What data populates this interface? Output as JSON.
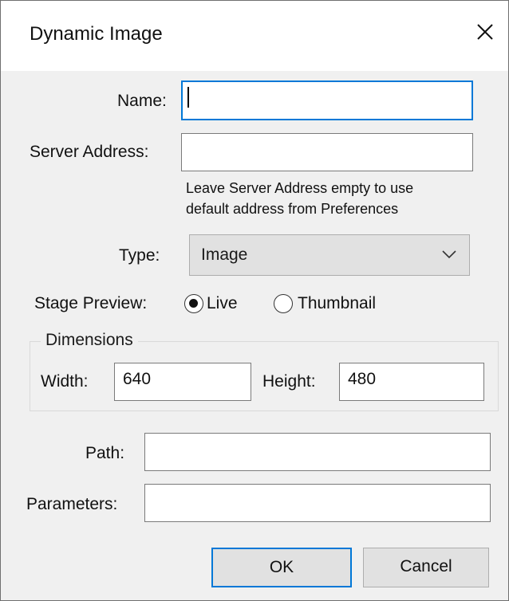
{
  "window": {
    "title": "Dynamic Image"
  },
  "form": {
    "name_label": "Name:",
    "name_value": "",
    "server_label": "Server Address:",
    "server_value": "",
    "server_hint_line1": "Leave Server Address empty to use",
    "server_hint_line2": "default address from Preferences",
    "type_label": "Type:",
    "type_value": "Image",
    "stage_preview_label": "Stage Preview:",
    "stage_preview_options": [
      {
        "label": "Live",
        "selected": true
      },
      {
        "label": "Thumbnail",
        "selected": false
      }
    ],
    "dimensions": {
      "legend": "Dimensions",
      "width_label": "Width:",
      "width_value": "640",
      "height_label": "Height:",
      "height_value": "480"
    },
    "path_label": "Path:",
    "path_value": "",
    "parameters_label": "Parameters:",
    "parameters_value": ""
  },
  "buttons": {
    "ok": "OK",
    "cancel": "Cancel"
  },
  "colors": {
    "accent": "#0078d7",
    "dialog_bg": "#f0f0f0"
  }
}
